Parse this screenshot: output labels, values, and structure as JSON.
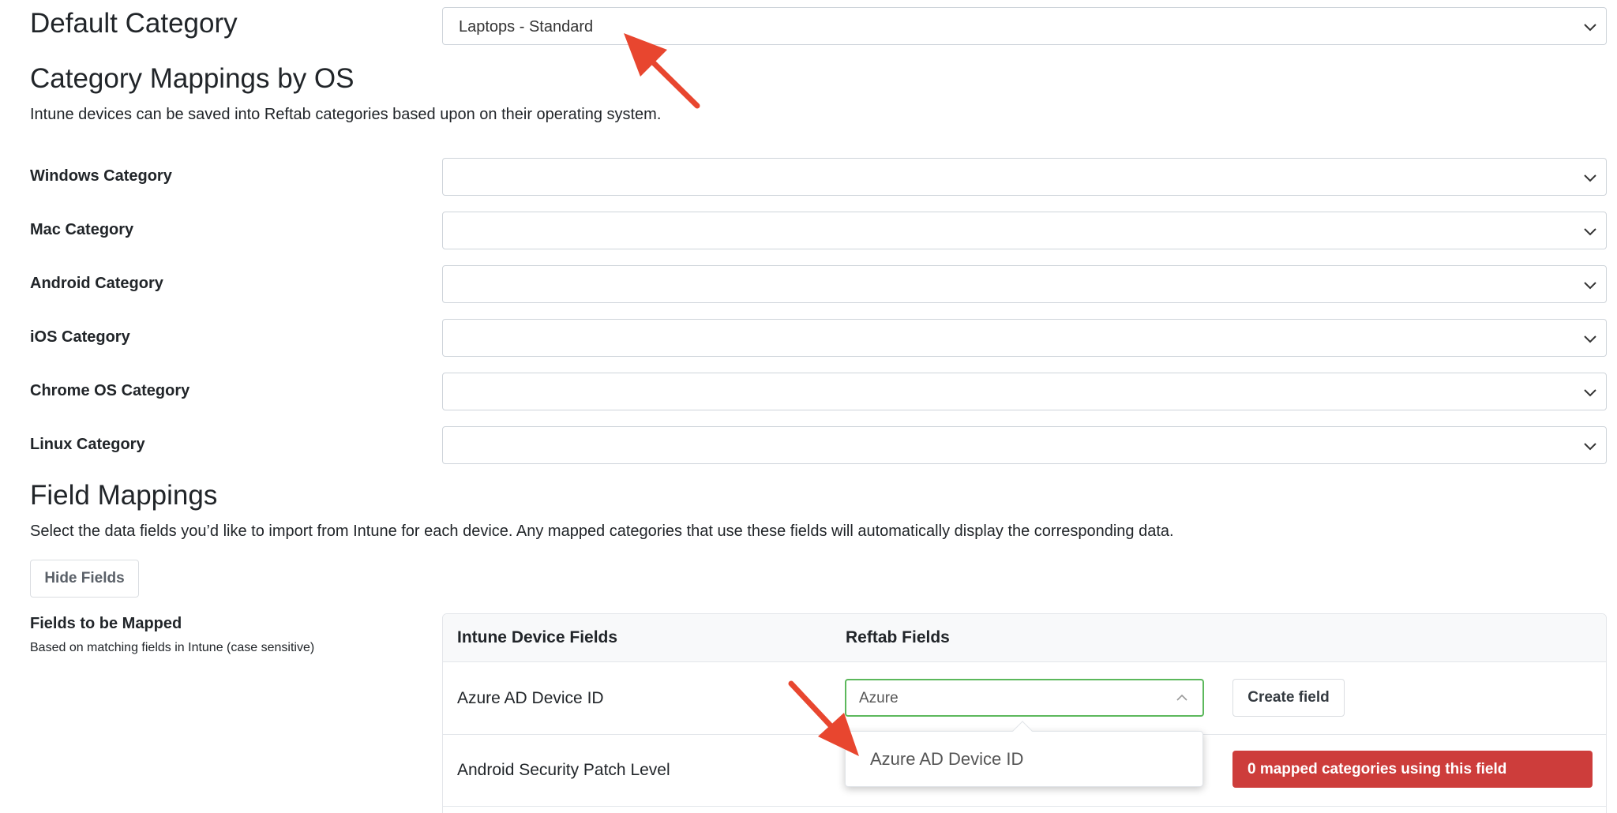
{
  "default_category": {
    "heading": "Default Category",
    "selected": "Laptops - Standard"
  },
  "category_mappings": {
    "heading": "Category Mappings by OS",
    "description": "Intune devices can be saved into Reftab categories based upon on their operating system.",
    "rows": [
      {
        "label": "Windows Category",
        "value": ""
      },
      {
        "label": "Mac Category",
        "value": ""
      },
      {
        "label": "Android Category",
        "value": ""
      },
      {
        "label": "iOS Category",
        "value": ""
      },
      {
        "label": "Chrome OS Category",
        "value": ""
      },
      {
        "label": "Linux Category",
        "value": ""
      }
    ]
  },
  "field_mappings": {
    "heading": "Field Mappings",
    "description": "Select the data fields you’d like to import from Intune for each device. Any mapped categories that use these fields will automatically display the corresponding data.",
    "hide_button": "Hide Fields",
    "sub_title": "Fields to be Mapped",
    "sub_description": "Based on matching fields in Intune (case sensitive)",
    "table": {
      "col_intune": "Intune Device Fields",
      "col_reftab": "Reftab Fields",
      "rows": [
        {
          "intune_field": "Azure AD Device ID",
          "reftab_input": "Azure",
          "action": "Create field"
        },
        {
          "intune_field": "Android Security Patch Level",
          "status": "0 mapped categories using this field"
        }
      ]
    },
    "dropdown_options": [
      "Azure AD Device ID"
    ]
  },
  "colors": {
    "accent_arrow": "#e8462f",
    "combo_border_active": "#5cb85c",
    "badge_red": "#cd3d3b"
  },
  "icons": {
    "select_chevron": "chevron-down-icon",
    "combo_chevron": "chevron-up-icon",
    "annotation": "arrow-icon"
  }
}
